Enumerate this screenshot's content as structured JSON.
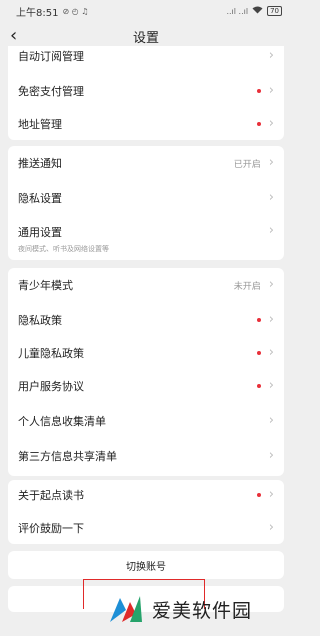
{
  "status_bar": {
    "time": "上午8:51",
    "icons_left": "⊘ ◴ ♫",
    "signal": "..ıl ..ıl",
    "wifi": "wifi-icon",
    "battery": "70"
  },
  "header": {
    "title": "设置",
    "back_icon": "‹"
  },
  "group1": [
    {
      "label": "自动订阅管理",
      "dot": false
    },
    {
      "label": "免密支付管理",
      "dot": true
    },
    {
      "label": "地址管理",
      "dot": true
    }
  ],
  "group2": [
    {
      "label": "推送通知",
      "status": "已开启"
    },
    {
      "label": "隐私设置"
    },
    {
      "label": "通用设置",
      "sub": "夜间模式、听书及网络设置等"
    }
  ],
  "group3": [
    {
      "label": "青少年模式",
      "status": "未开启"
    },
    {
      "label": "隐私政策",
      "dot": true
    },
    {
      "label": "儿童隐私政策",
      "dot": true
    },
    {
      "label": "用户服务协议",
      "dot": true
    },
    {
      "label": "个人信息收集清单"
    },
    {
      "label": "第三方信息共享清单"
    }
  ],
  "group4": [
    {
      "label": "关于起点读书",
      "dot": true
    },
    {
      "label": "评价鼓励一下"
    }
  ],
  "switch_account": "切换账号",
  "watermark": {
    "text": "爱美软件园"
  },
  "colors": {
    "dot": "#e8303a",
    "background": "#efefef",
    "frame": "#e02a2a"
  }
}
